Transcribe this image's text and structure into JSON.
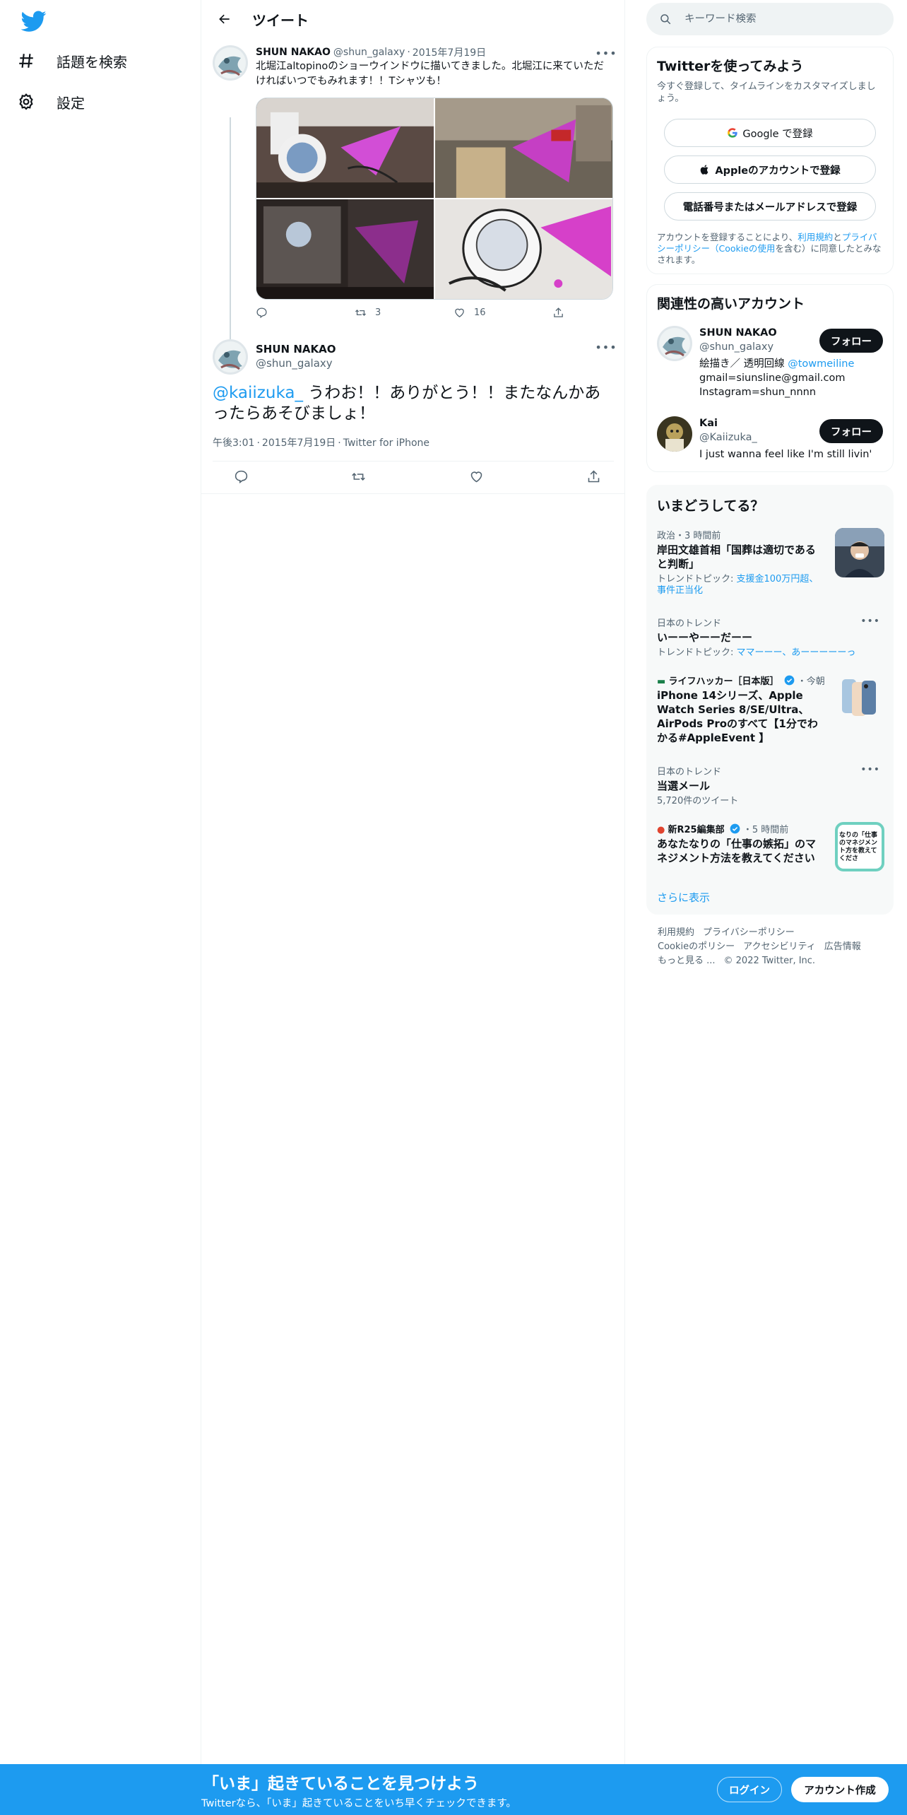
{
  "nav": {
    "logo": "twitter-bird-icon",
    "items": [
      {
        "label": "話題を検索",
        "icon": "hashtag-icon"
      },
      {
        "label": "設定",
        "icon": "gear-icon"
      }
    ]
  },
  "main": {
    "header_title": "ツイート",
    "tweet1": {
      "name": "SHUN NAKAO",
      "handle": "@shun_galaxy",
      "dot": "·",
      "date": "2015年7月19日",
      "text": "北堀江altopinoのショーウインドウに描いてきました。北堀江に来ていただければいつでもみれます！！Tシャツも！",
      "retweets": "3",
      "likes": "16"
    },
    "tweet2": {
      "name": "SHUN NAKAO",
      "handle": "@shun_galaxy",
      "mention": "@kaiizuka_",
      "text": " うわお！！ありがとう！！またなんかあったらあそびましょ！",
      "time": "午後3:01",
      "dot": "·",
      "date": "2015年7月19日",
      "source": "Twitter for iPhone"
    }
  },
  "search": {
    "placeholder": "キーワード検索"
  },
  "signup": {
    "title": "Twitterを使ってみよう",
    "subtitle": "今すぐ登録して、タイムラインをカスタマイズしましょう。",
    "google_label": "Google で登録",
    "apple_label": "Appleのアカウントで登録",
    "phone_label": "電話番号またはメールアドレスで登録",
    "terms_prefix": "アカウントを登録することにより、",
    "terms_link1": "利用規約",
    "terms_and": "と",
    "terms_link2": "プライバシーポリシー（Cookieの使用",
    "terms_suffix": "を含む）に同意したとみなされます。"
  },
  "relevant": {
    "title": "関連性の高いアカウント",
    "follow_label": "フォロー",
    "accounts": [
      {
        "name": "SHUN NAKAO",
        "handle": "@shun_galaxy",
        "bio1": "絵描き／ 透明回線 ",
        "bio_link": "@towmeiline",
        "bio2": "gmail=siunsline@gmail.com",
        "bio3": "Instagram=shun_nnnn"
      },
      {
        "name": "Kai",
        "handle": "@Kaiizuka_",
        "bio1": "I just wanna feel like I'm still livin'"
      }
    ]
  },
  "trends": {
    "title": "いまどうしてる？",
    "items": [
      {
        "context": "政治・3 時間前",
        "title": "岸田文雄首相「国葬は適切であると判断」",
        "topics_prefix": "トレンドトピック: ",
        "topics": "支援金100万円超、事件正当化"
      },
      {
        "context": "日本のトレンド",
        "title": "いーーやーーだーー",
        "topics_prefix": "トレンドトピック: ",
        "topics": "ママーーー、あーーーーーっ"
      },
      {
        "source": "ライフハッカー［日本版］",
        "time": "・今朝",
        "title": "iPhone 14シリーズ、Apple Watch Series 8/SE/Ultra、AirPods Proのすべて【1分でわかる#AppleEvent 】"
      },
      {
        "context": "日本のトレンド",
        "title": "当選メール",
        "count": "5,720件のツイート"
      },
      {
        "source": "新R25編集部",
        "time": "・5 時間前",
        "title": "あなたなりの「仕事の嫉拓」のマネジメント方法を教えてください",
        "thumb_text": "なりの「仕事のマネジメント方を教えてくださ"
      }
    ],
    "show_more": "さらに表示"
  },
  "footer": {
    "line1": [
      "利用規約",
      "プライバシーポリシー"
    ],
    "line2": [
      "Cookieのポリシー",
      "アクセシビリティ",
      "広告情報"
    ],
    "line3": [
      "もっと見る ...",
      "© 2022 Twitter, Inc."
    ]
  },
  "banner": {
    "title": "「いま」起きていることを見つけよう",
    "subtitle": "Twitterなら、「いま」起きていることをいち早くチェックできます。",
    "login_label": "ログイン",
    "create_label": "アカウント作成"
  },
  "colors": {
    "accent": "#1d9bf0",
    "text": "#0f1419",
    "muted": "#536471",
    "border": "#eff3f4",
    "card_bg": "#f7f9f9"
  }
}
